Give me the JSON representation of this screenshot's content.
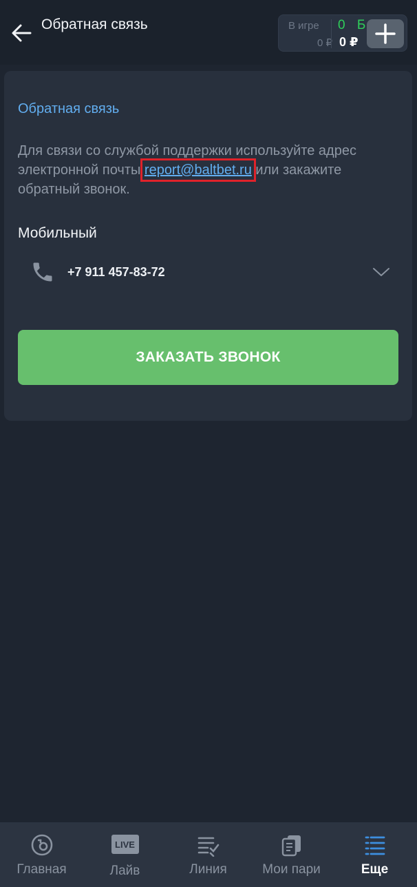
{
  "header": {
    "title": "Обратная связь",
    "balance": {
      "in_game_label": "В игре",
      "in_game_value": "0 ₽",
      "bonus": "0 Б",
      "money": "0 ₽"
    }
  },
  "card": {
    "title": "Обратная связь",
    "desc_before": "Для связи со службой поддержки используйте адрес электронной почты ",
    "email": "report@baltbet.ru",
    "desc_after": " или закажите обратный звонок.",
    "mobile_label": "Мобильный",
    "phone": "+7 911 457-83-72",
    "call_button": "ЗАКАЗАТЬ ЗВОНОК"
  },
  "nav": {
    "items": [
      {
        "label": "Главная",
        "icon": "home-icon"
      },
      {
        "label": "Лайв",
        "icon": "live-icon",
        "badge": "LIVE"
      },
      {
        "label": "Линия",
        "icon": "line-list-icon"
      },
      {
        "label": "Мои пари",
        "icon": "my-bets-icon"
      },
      {
        "label": "Еще",
        "icon": "menu-icon",
        "active": true
      }
    ]
  },
  "colors": {
    "background": "#1e2530",
    "card": "#28303d",
    "accent_link": "#62aef0",
    "button_green": "#67bf6d",
    "bonus_green": "#2fcf5a",
    "active_nav": "#3d8fe0",
    "highlight_box": "#e0222a"
  }
}
